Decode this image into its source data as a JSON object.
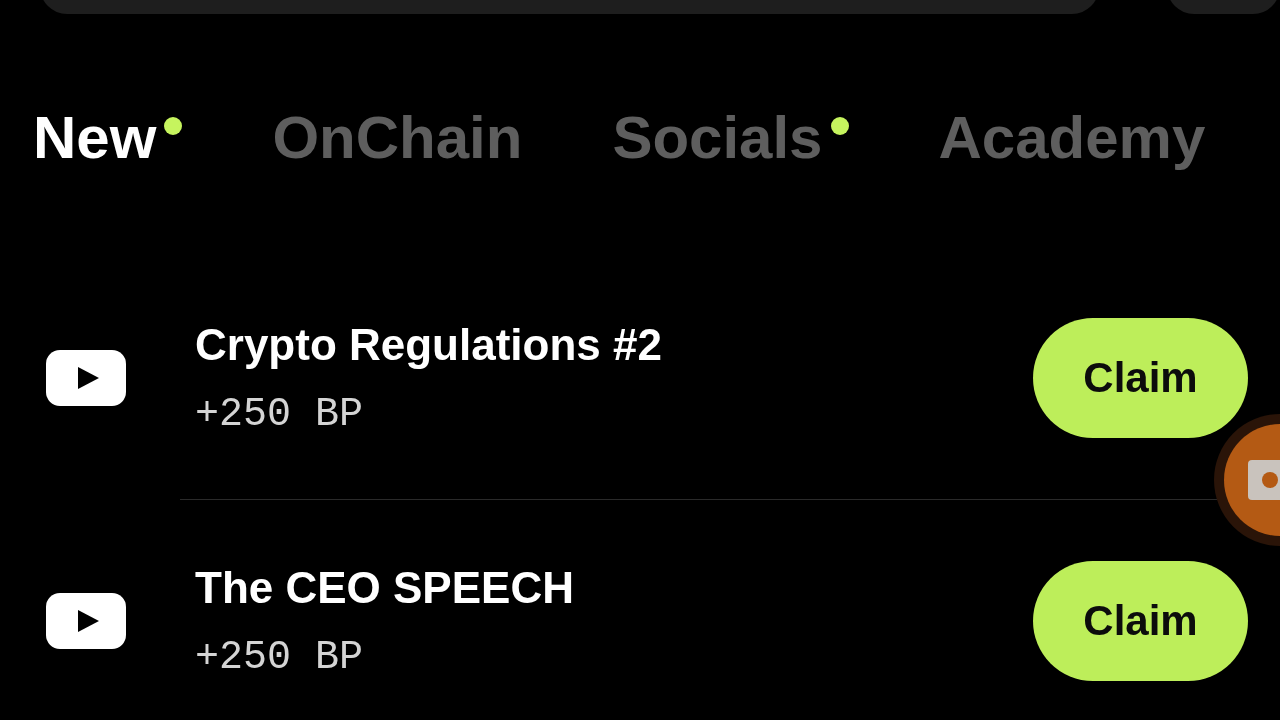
{
  "tabs": [
    {
      "label": "New",
      "selected": true,
      "dot": true
    },
    {
      "label": "OnChain",
      "selected": false,
      "dot": false
    },
    {
      "label": "Socials",
      "selected": false,
      "dot": true
    },
    {
      "label": "Academy",
      "selected": false,
      "dot": false
    }
  ],
  "tasks": [
    {
      "title": "Crypto Regulations #2",
      "reward": "+250 BP",
      "button": "Claim"
    },
    {
      "title": "The CEO SPEECH",
      "reward": "+250 BP",
      "button": "Claim"
    }
  ]
}
